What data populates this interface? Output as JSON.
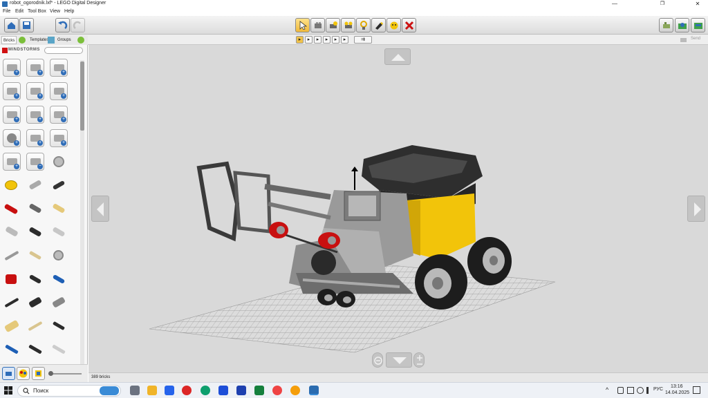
{
  "window": {
    "title": "robot_ogorodnik.lxf* - LEGO Digital Designer",
    "minimize": "—",
    "maximize": "❐",
    "close": "✕"
  },
  "menu": {
    "items": [
      "File",
      "Edit",
      "Tool Box",
      "View",
      "Help"
    ]
  },
  "toolbar": {
    "left_icons": [
      "home-icon",
      "save-icon",
      "undo-icon",
      "redo-icon"
    ],
    "center_tools": [
      "select-tool-icon",
      "clone-tool-icon",
      "hinge-tool-icon",
      "hinge-align-tool-icon",
      "flex-tool-icon",
      "paint-tool-icon",
      "hide-tool-icon",
      "delete-tool-icon"
    ],
    "right_icons": [
      "build-mode-icon",
      "view-mode-icon",
      "building-guide-icon"
    ],
    "send_label": "Send"
  },
  "panel": {
    "tabs": [
      "Bricks",
      "Templates",
      "Groups"
    ],
    "theme_logo": "MINDSTORMS",
    "search_placeholder": ""
  },
  "status": {
    "brick_count": "389 bricks"
  },
  "taskbar": {
    "search_label": "Поиск",
    "language": "РУС",
    "time": "13:16",
    "date": "14.04.2025"
  },
  "colors": {
    "viewport_bg": "#d9d9d9",
    "accent_yellow": "#f2c40a",
    "delete_red": "#cc1111",
    "selected_tool": "#f0c24b"
  }
}
